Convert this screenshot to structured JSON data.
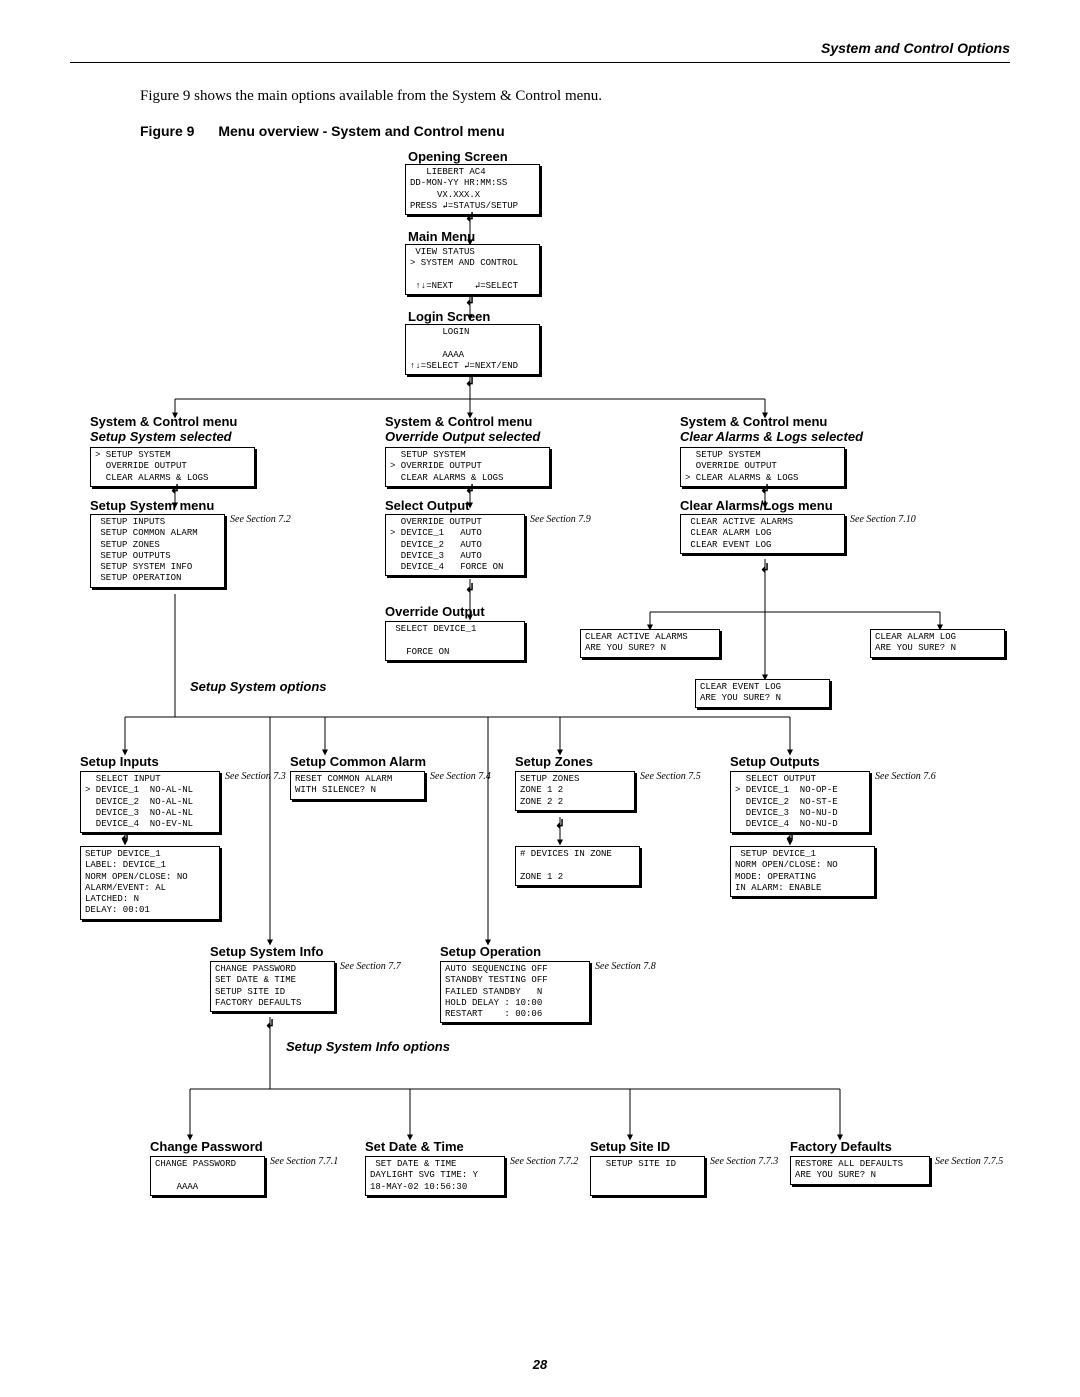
{
  "header": {
    "section": "System and Control Options"
  },
  "intro": "Figure 9 shows the main options available from the System & Control menu.",
  "figure": {
    "num": "Figure 9",
    "title": "Menu overview - System and Control menu"
  },
  "labels": {
    "opening": "Opening Screen",
    "mainmenu": "Main Menu",
    "login": "Login Screen",
    "sc1_t": "System & Control menu",
    "sc1_s": "Setup System selected",
    "sc2_t": "System & Control menu",
    "sc2_s": "Override Output selected",
    "sc3_t": "System & Control menu",
    "sc3_s": "Clear Alarms & Logs selected",
    "setup_sys_menu": "Setup System menu",
    "select_output": "Select Output",
    "clear_menu": "Clear Alarms/Logs menu",
    "override_output": "Override Output",
    "setup_sys_opts": "Setup System options",
    "setup_inputs": "Setup Inputs",
    "setup_common": "Setup Common Alarm",
    "setup_zones": "Setup Zones",
    "setup_outputs": "Setup Outputs",
    "setup_sysinfo": "Setup System Info",
    "setup_operation": "Setup Operation",
    "sysinfo_opts": "Setup System Info options",
    "chg_pw": "Change Password",
    "set_dt": "Set Date & Time",
    "site_id": "Setup Site ID",
    "factory": "Factory Defaults"
  },
  "screens": {
    "opening": "   LIEBERT AC4\nDD-MON-YY HR:MM:SS\n     VX.XXX.X\nPRESS ↲=STATUS/SETUP",
    "mainmenu": " VIEW STATUS\n> SYSTEM AND CONTROL\n\n ↑↓=NEXT    ↲=SELECT",
    "login": "      LOGIN\n\n      AAAA\n↑↓=SELECT ↲=NEXT/END",
    "sc1": "> SETUP SYSTEM\n  OVERRIDE OUTPUT\n  CLEAR ALARMS & LOGS",
    "sc2": "  SETUP SYSTEM\n> OVERRIDE OUTPUT\n  CLEAR ALARMS & LOGS",
    "sc3": "  SETUP SYSTEM\n  OVERRIDE OUTPUT\n> CLEAR ALARMS & LOGS",
    "setup_sys_menu": " SETUP INPUTS\n SETUP COMMON ALARM\n SETUP ZONES\n SETUP OUTPUTS\n SETUP SYSTEM INFO\n SETUP OPERATION",
    "select_output": "  OVERRIDE OUTPUT\n> DEVICE_1   AUTO\n  DEVICE_2   AUTO\n  DEVICE_3   AUTO\n  DEVICE_4   FORCE ON",
    "clear_menu": " CLEAR ACTIVE ALARMS\n CLEAR ALARM LOG\n CLEAR EVENT LOG",
    "override_output": " SELECT DEVICE_1\n\n   FORCE ON",
    "clear_active": "CLEAR ACTIVE ALARMS\nARE YOU SURE? N",
    "clear_alarm_log": "CLEAR ALARM LOG\nARE YOU SURE? N",
    "clear_event": "CLEAR EVENT LOG\nARE YOU SURE? N",
    "setup_inputs": "  SELECT INPUT\n> DEVICE_1  NO-AL-NL\n  DEVICE_2  NO-AL-NL\n  DEVICE_3  NO-AL-NL\n  DEVICE_4  NO-EV-NL",
    "setup_inputs2": "SETUP DEVICE_1\nLABEL: DEVICE_1\nNORM OPEN/CLOSE: NO\nALARM/EVENT: AL\nLATCHED: N\nDELAY: 00:01",
    "setup_common": "RESET COMMON ALARM\nWITH SILENCE? N",
    "setup_zones": "SETUP ZONES\nZONE 1 2\nZONE 2 2",
    "setup_zones2": "# DEVICES IN ZONE\n\nZONE 1 2",
    "setup_outputs": "  SELECT OUTPUT\n> DEVICE_1  NO-OP-E\n  DEVICE_2  NO-ST-E\n  DEVICE_3  NO-NU-D\n  DEVICE_4  NO-NU-D",
    "setup_outputs2": " SETUP DEVICE_1\nNORM OPEN/CLOSE: NO\nMODE: OPERATING\nIN ALARM: ENABLE",
    "setup_sysinfo": "CHANGE PASSWORD\nSET DATE & TIME\nSETUP SITE ID\nFACTORY DEFAULTS",
    "setup_operation": "AUTO SEQUENCING OFF\nSTANDBY TESTING OFF\nFAILED STANDBY   N\nHOLD DELAY : 10:00\nRESTART    : 00:06",
    "chg_pw": "CHANGE PASSWORD\n\n    AAAA",
    "set_dt": " SET DATE & TIME\nDAYLIGHT SVG TIME: Y\n18-MAY-02 10:56:30",
    "site_id": "  SETUP SITE ID\n",
    "factory": "RESTORE ALL DEFAULTS\nARE YOU SURE? N"
  },
  "refs": {
    "r72": "See\nSection\n7.2",
    "r79": "See\nSection\n7.9",
    "r710": "See\nSection\n7.10",
    "r73": "See\nSection\n7.3",
    "r74": "See\nSection\n7.4",
    "r75": "See\nSection\n7.5",
    "r76": "See\nSection\n7.6",
    "r77": "See\nSection\n7.7",
    "r78": "See\nSection\n7.8",
    "r771": "See\nSection\n7.7.1",
    "r772": "See\nSection\n7.7.2",
    "r773": "See\nSection\n7.7.3",
    "r775": "See\nSection\n7.7.5"
  },
  "page_number": "28"
}
